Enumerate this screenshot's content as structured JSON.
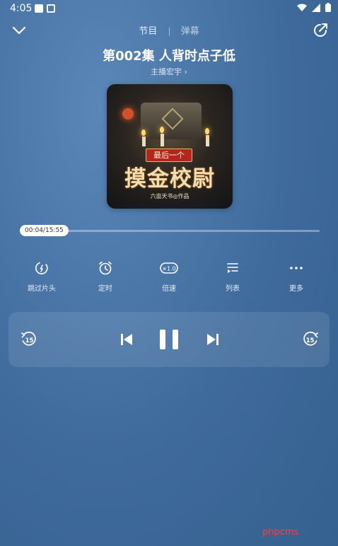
{
  "status_bar": {
    "time": "4:05"
  },
  "header": {
    "tabs": [
      {
        "label": "节目"
      },
      {
        "label": "弹幕"
      }
    ]
  },
  "episode": {
    "title": "第002集 人背时点子低",
    "anchor": "主播宏宇"
  },
  "cover": {
    "badge": "最后一个",
    "title": "摸金校尉",
    "author": "六亩天书◎作品"
  },
  "progress": {
    "time_label": "00:04/15:55",
    "fraction": 0.004
  },
  "functions": [
    {
      "label": "跳过片头",
      "icon": "skip-intro-icon"
    },
    {
      "label": "定时",
      "icon": "alarm-clock-icon"
    },
    {
      "label": "倍速",
      "icon": "speed-1x-icon",
      "badge": "×1.0"
    },
    {
      "label": "列表",
      "icon": "playlist-icon"
    },
    {
      "label": "更多",
      "icon": "more-dots-icon"
    }
  ],
  "player": {
    "rewind_seconds": "15",
    "forward_seconds": "15"
  },
  "watermark": "phpcms"
}
